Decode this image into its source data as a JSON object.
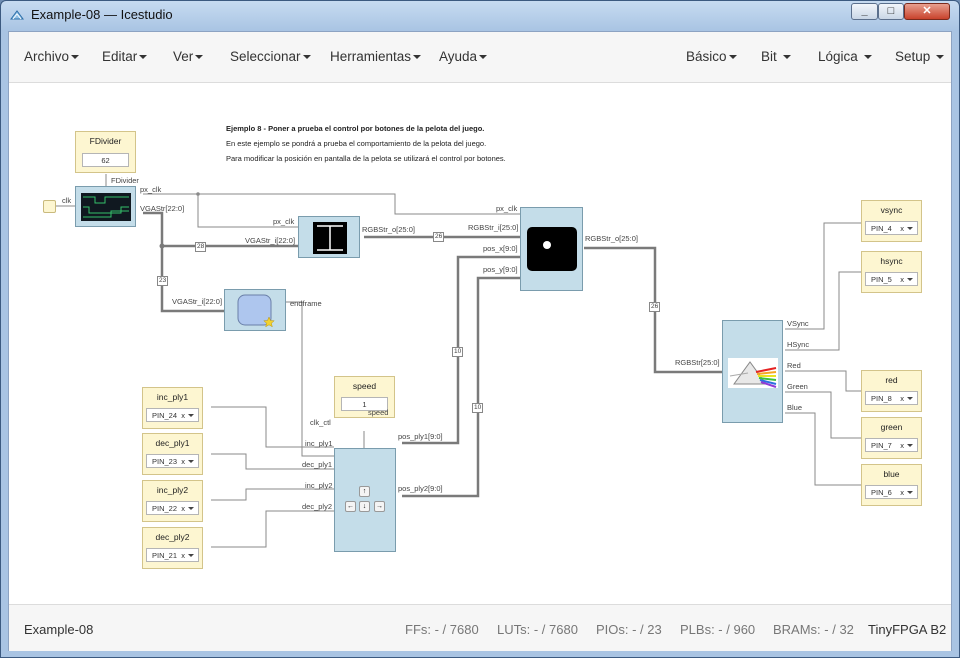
{
  "window": {
    "title": "Example-08 — Icestudio"
  },
  "menu": {
    "left": [
      "Archivo",
      "Editar",
      "Ver",
      "Seleccionar",
      "Herramientas",
      "Ayuda"
    ],
    "right": [
      "Básico",
      "Bit",
      "Lógica",
      "Setup"
    ]
  },
  "description": {
    "title": "Ejemplo 8 - Poner a prueba el control por botones de la pelota del juego.",
    "line1": "En este ejemplo se pondrá a prueba el comportamiento de la pelota del juego.",
    "line2": "Para modificar la posición en pantalla de la pelota se utilizará el control por botones."
  },
  "fdivider": {
    "name": "FDivider",
    "value": "62",
    "label": "FDivider"
  },
  "speed": {
    "name": "speed",
    "value": "1",
    "port": "speed"
  },
  "inputs": [
    {
      "name": "inc_ply1",
      "pin": "PIN_24",
      "port": "inc_ply1"
    },
    {
      "name": "dec_ply1",
      "pin": "PIN_23",
      "port": "dec_ply1"
    },
    {
      "name": "inc_ply2",
      "pin": "PIN_22",
      "port": "inc_ply2"
    },
    {
      "name": "dec_ply2",
      "pin": "PIN_21",
      "port": "dec_ply2"
    }
  ],
  "outputs": [
    {
      "name": "vsync",
      "pin": "PIN_4"
    },
    {
      "name": "hsync",
      "pin": "PIN_5"
    },
    {
      "name": "red",
      "pin": "PIN_8"
    },
    {
      "name": "green",
      "pin": "PIN_7"
    },
    {
      "name": "blue",
      "pin": "PIN_6"
    }
  ],
  "pin_clear": "x",
  "labels": {
    "clk": "clk",
    "px_clk": "px_clk",
    "vgastr": "VGAStr[22:0]",
    "px_clk2": "px_clk",
    "vgastr_i": "VGAStr_i[22:0]",
    "rgbstr_o": "RGBStr_o[25:0]",
    "vgastr_i2": "VGAStr_i[22:0]",
    "endframe": "endframe",
    "px_clk3": "px_clk",
    "rgbstr_i": "RGBStr_i[25:0]",
    "pos_x": "pos_x[9:0]",
    "pos_y": "pos_y[9:0]",
    "rgbstr_o2": "RGBStr_o[25:0]",
    "rgbstr_in": "RGBStr[25:0]",
    "vsync": "VSync",
    "hsync": "HSync",
    "red": "Red",
    "green": "Green",
    "blue": "Blue",
    "clk_ctl": "clk_ctl",
    "pos_ply1": "pos_ply1[9:0]",
    "pos_ply2": "pos_ply2[9:0]"
  },
  "bus_widths": {
    "b28": "28",
    "b23": "23",
    "b26a": "26",
    "b10a": "10",
    "b10b": "10",
    "b26b": "26"
  },
  "status": {
    "project": "Example-08",
    "ffs": "FFs:  - / 7680",
    "luts": "LUTs:  - / 7680",
    "pios": "PIOs:  - / 23",
    "plbs": "PLBs:  - / 960",
    "brams": "BRAMs:  - / 32",
    "board": "TinyFPGA B2"
  }
}
